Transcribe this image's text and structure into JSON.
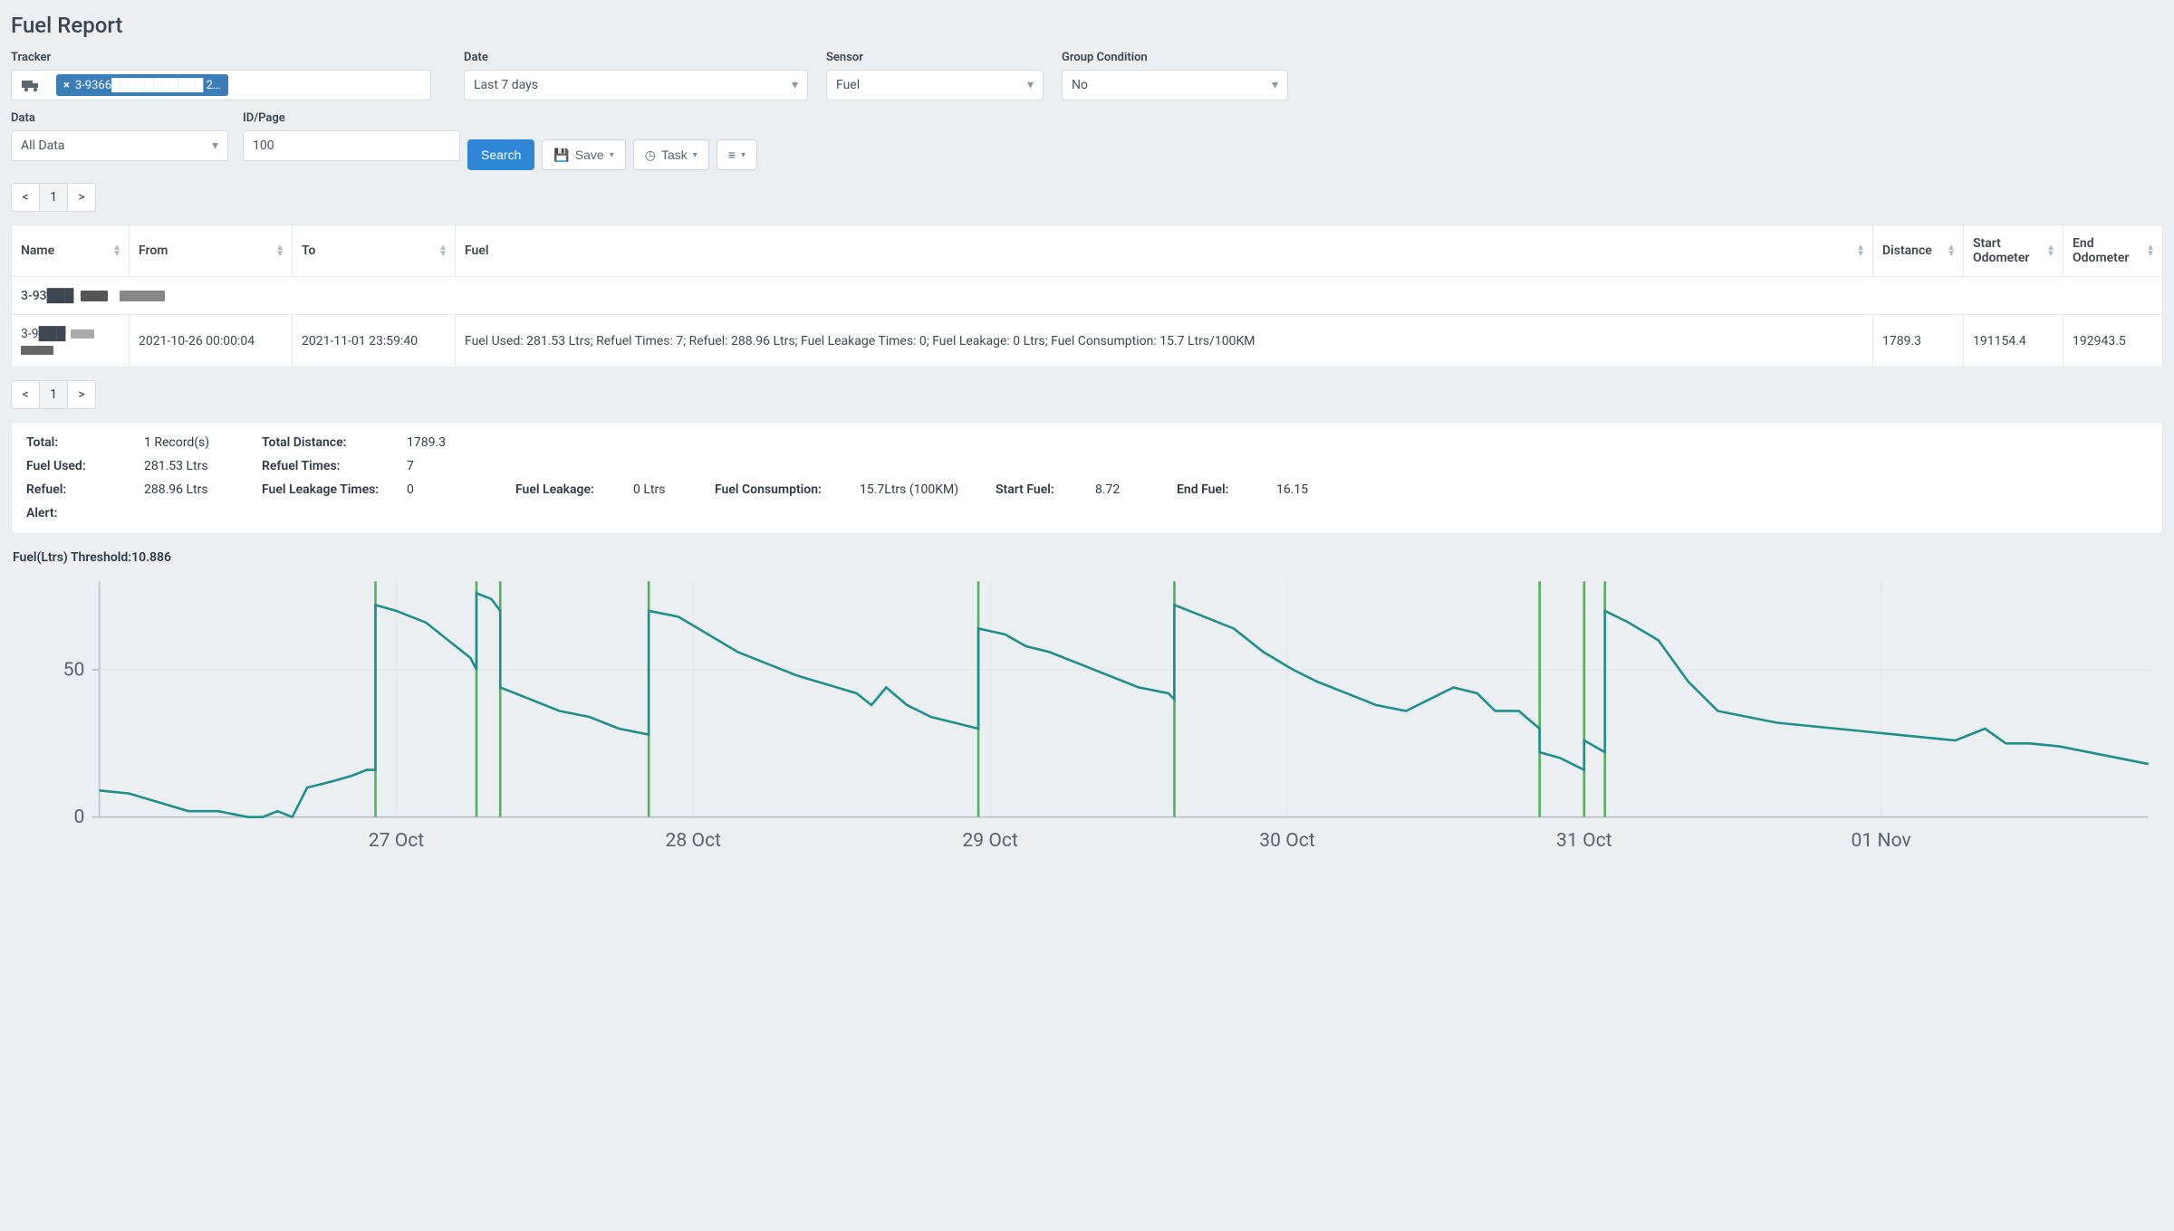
{
  "page": {
    "title": "Fuel Report"
  },
  "filters": {
    "tracker": {
      "label": "Tracker",
      "tag_text": "3-9366███████████ 2…"
    },
    "date": {
      "label": "Date",
      "value": "Last 7 days"
    },
    "sensor": {
      "label": "Sensor",
      "value": "Fuel"
    },
    "group": {
      "label": "Group Condition",
      "value": "No"
    },
    "data": {
      "label": "Data",
      "value": "All Data"
    },
    "idpage": {
      "label": "ID/Page",
      "value": "100"
    }
  },
  "buttons": {
    "search": "Search",
    "save": "Save",
    "task": "Task"
  },
  "pager": {
    "prev": "<",
    "page": "1",
    "next": ">"
  },
  "table": {
    "headers": {
      "name": "Name",
      "from": "From",
      "to": "To",
      "fuel": "Fuel",
      "distance": "Distance",
      "start_odo": "Start Odometer",
      "end_odo": "End Odometer"
    },
    "group_name": "3-93███",
    "row": {
      "name": "3-9███",
      "from": "2021-10-26 00:00:04",
      "to": "2021-11-01 23:59:40",
      "fuel": "Fuel Used: 281.53 Ltrs; Refuel Times: 7; Refuel: 288.96 Ltrs; Fuel Leakage Times: 0; Fuel Leakage: 0 Ltrs; Fuel Consumption: 15.7 Ltrs/100KM",
      "distance": "1789.3",
      "start_odo": "191154.4",
      "end_odo": "192943.5"
    }
  },
  "summary": {
    "total_lbl": "Total:",
    "total_val": "1 Record(s)",
    "td_lbl": "Total Distance:",
    "td_val": "1789.3",
    "fu_lbl": "Fuel Used:",
    "fu_val": "281.53 Ltrs",
    "rt_lbl": "Refuel Times:",
    "rt_val": "7",
    "rf_lbl": "Refuel:",
    "rf_val": "288.96 Ltrs",
    "flt_lbl": "Fuel Leakage Times:",
    "flt_val": "0",
    "fl_lbl": "Fuel Leakage:",
    "fl_val": "0 Ltrs",
    "fc_lbl": "Fuel Consumption:",
    "fc_val": "15.7Ltrs (100KM)",
    "sf_lbl": "Start Fuel:",
    "sf_val": "8.72",
    "ef_lbl": "End Fuel:",
    "ef_val": "16.15",
    "alert_lbl": "Alert:"
  },
  "chart_title": "Fuel(Ltrs) Threshold:10.886",
  "chart_data": {
    "type": "line",
    "ylabel": "Fuel (Ltrs)",
    "ylim": [
      0,
      80
    ],
    "y_ticks": [
      0,
      50
    ],
    "x_ticks": [
      "27 Oct",
      "28 Oct",
      "29 Oct",
      "30 Oct",
      "31 Oct",
      "01 Nov"
    ],
    "x_range_days": 6.9,
    "refuel_x": [
      0.93,
      1.27,
      1.35,
      1.85,
      2.96,
      3.62,
      4.85,
      5.0,
      5.07
    ],
    "series": {
      "name": "Fuel",
      "points": [
        [
          0.0,
          9
        ],
        [
          0.1,
          8
        ],
        [
          0.2,
          5
        ],
        [
          0.3,
          2
        ],
        [
          0.4,
          2
        ],
        [
          0.5,
          0
        ],
        [
          0.55,
          0
        ],
        [
          0.6,
          2
        ],
        [
          0.65,
          0
        ],
        [
          0.7,
          10
        ],
        [
          0.78,
          12
        ],
        [
          0.85,
          14
        ],
        [
          0.9,
          16
        ],
        [
          0.93,
          16
        ],
        [
          0.93,
          72
        ],
        [
          1.0,
          70
        ],
        [
          1.05,
          68
        ],
        [
          1.1,
          66
        ],
        [
          1.15,
          62
        ],
        [
          1.2,
          58
        ],
        [
          1.25,
          54
        ],
        [
          1.27,
          50
        ],
        [
          1.27,
          76
        ],
        [
          1.32,
          74
        ],
        [
          1.35,
          70
        ],
        [
          1.35,
          44
        ],
        [
          1.45,
          40
        ],
        [
          1.55,
          36
        ],
        [
          1.65,
          34
        ],
        [
          1.75,
          30
        ],
        [
          1.85,
          28
        ],
        [
          1.85,
          70
        ],
        [
          1.95,
          68
        ],
        [
          2.05,
          62
        ],
        [
          2.15,
          56
        ],
        [
          2.25,
          52
        ],
        [
          2.35,
          48
        ],
        [
          2.45,
          45
        ],
        [
          2.55,
          42
        ],
        [
          2.6,
          38
        ],
        [
          2.65,
          44
        ],
        [
          2.72,
          38
        ],
        [
          2.8,
          34
        ],
        [
          2.88,
          32
        ],
        [
          2.96,
          30
        ],
        [
          2.96,
          64
        ],
        [
          3.05,
          62
        ],
        [
          3.12,
          58
        ],
        [
          3.2,
          56
        ],
        [
          3.3,
          52
        ],
        [
          3.4,
          48
        ],
        [
          3.5,
          44
        ],
        [
          3.6,
          42
        ],
        [
          3.62,
          40
        ],
        [
          3.62,
          72
        ],
        [
          3.72,
          68
        ],
        [
          3.82,
          64
        ],
        [
          3.92,
          56
        ],
        [
          4.02,
          50
        ],
        [
          4.1,
          46
        ],
        [
          4.2,
          42
        ],
        [
          4.3,
          38
        ],
        [
          4.4,
          36
        ],
        [
          4.48,
          40
        ],
        [
          4.56,
          44
        ],
        [
          4.64,
          42
        ],
        [
          4.7,
          36
        ],
        [
          4.78,
          36
        ],
        [
          4.85,
          30
        ],
        [
          4.85,
          22
        ],
        [
          4.92,
          20
        ],
        [
          5.0,
          16
        ],
        [
          5.0,
          26
        ],
        [
          5.07,
          22
        ],
        [
          5.07,
          70
        ],
        [
          5.15,
          66
        ],
        [
          5.25,
          60
        ],
        [
          5.35,
          46
        ],
        [
          5.45,
          36
        ],
        [
          5.55,
          34
        ],
        [
          5.65,
          32
        ],
        [
          5.75,
          31
        ],
        [
          5.85,
          30
        ],
        [
          5.95,
          29
        ],
        [
          6.05,
          28
        ],
        [
          6.15,
          27
        ],
        [
          6.25,
          26
        ],
        [
          6.3,
          28
        ],
        [
          6.35,
          30
        ],
        [
          6.42,
          25
        ],
        [
          6.5,
          25
        ],
        [
          6.6,
          24
        ],
        [
          6.7,
          22
        ],
        [
          6.8,
          20
        ],
        [
          6.9,
          18
        ]
      ]
    }
  }
}
